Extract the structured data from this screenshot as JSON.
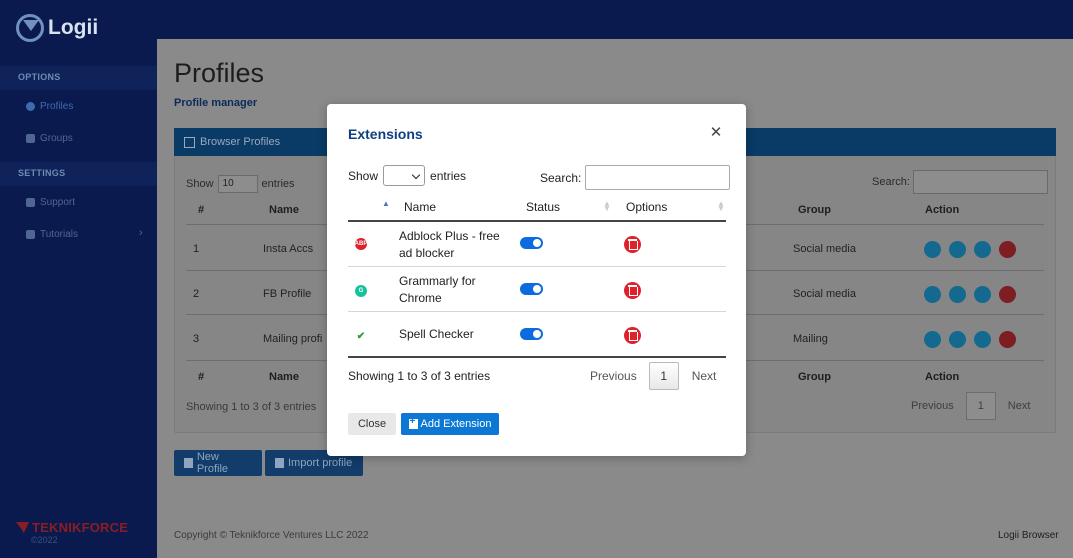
{
  "app": {
    "name": "Logii",
    "brand": "TEKNIKFORCE",
    "brand_year": "©2022"
  },
  "sidebar": {
    "sections": [
      {
        "label": "OPTIONS",
        "items": [
          {
            "label": "Profiles",
            "icon": "user-icon",
            "active": true
          },
          {
            "label": "Groups",
            "icon": "users-icon",
            "active": false
          }
        ]
      },
      {
        "label": "SETTINGS",
        "items": [
          {
            "label": "Support",
            "icon": "cloud-icon",
            "active": false
          },
          {
            "label": "Tutorials",
            "icon": "book-icon",
            "active": false
          }
        ]
      }
    ]
  },
  "page": {
    "title": "Profiles",
    "subtitle": "Profile manager"
  },
  "profiles_card": {
    "header": "Browser Profiles",
    "show_label": "Show",
    "show_value": "10",
    "entries_label": "entries",
    "search_label": "Search:",
    "columns": [
      "#",
      "Name",
      "Group",
      "Action"
    ],
    "rows": [
      {
        "num": "1",
        "name": "Insta Accs",
        "group": "Social media"
      },
      {
        "num": "2",
        "name": "FB Profile",
        "group": "Social media"
      },
      {
        "num": "3",
        "name": "Mailing profi",
        "group": "Mailing"
      }
    ],
    "info": "Showing 1 to 3 of 3 entries",
    "pagination": {
      "previous": "Previous",
      "page": "1",
      "next": "Next"
    }
  },
  "buttons": {
    "new_profile": "New Profile",
    "import_profile": "Import profile"
  },
  "footer": {
    "copyright": "Copyright © Teknikforce Ventures LLC 2022",
    "product": "Logii Browser"
  },
  "modal": {
    "title": "Extensions",
    "show_label": "Show",
    "entries_label": "entries",
    "search_label": "Search:",
    "columns": [
      "Name",
      "Status",
      "Options"
    ],
    "rows": [
      {
        "name": "Adblock Plus - free ad blocker",
        "icon": "adblock-icon",
        "icon_color": "#e0202a",
        "enabled": true
      },
      {
        "name": "Grammarly for Chrome",
        "icon": "grammarly-icon",
        "icon_color": "#15c39a",
        "enabled": true
      },
      {
        "name": "Spell Checker",
        "icon": "checkmark-icon",
        "icon_color": "#2e9b3f",
        "enabled": true
      }
    ],
    "info": "Showing 1 to 3 of 3 entries",
    "pagination": {
      "previous": "Previous",
      "page": "1",
      "next": "Next"
    },
    "close_label": "Close",
    "add_label": "Add Extension"
  },
  "colors": {
    "accent": "#0c78d4",
    "sidebar": "#0b1a4e",
    "danger": "#e0202a",
    "toggle": "#0c6cdf"
  }
}
